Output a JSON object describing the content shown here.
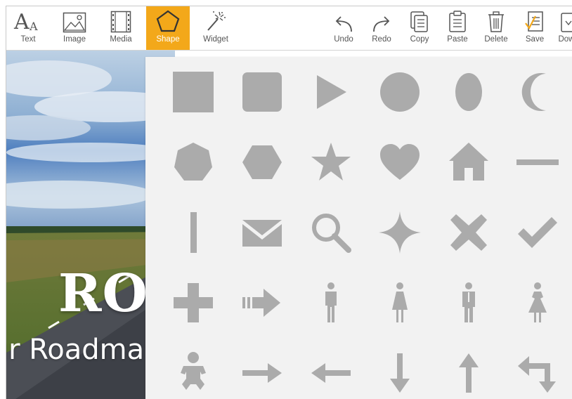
{
  "toolbar": {
    "left_tools": [
      {
        "name": "text",
        "label": "Text",
        "icon": "text-icon"
      },
      {
        "name": "image",
        "label": "Image",
        "icon": "image-icon"
      },
      {
        "name": "media",
        "label": "Media",
        "icon": "film-icon"
      },
      {
        "name": "shape",
        "label": "Shape",
        "icon": "pentagon-icon",
        "active": true
      },
      {
        "name": "widget",
        "label": "Widget",
        "icon": "magic-wand-icon"
      }
    ],
    "right_tools": [
      {
        "name": "undo",
        "label": "Undo",
        "icon": "undo-icon"
      },
      {
        "name": "redo",
        "label": "Redo",
        "icon": "redo-icon"
      },
      {
        "name": "copy",
        "label": "Copy",
        "icon": "copy-icon"
      },
      {
        "name": "paste",
        "label": "Paste",
        "icon": "paste-icon"
      },
      {
        "name": "delete",
        "label": "Delete",
        "icon": "trash-icon"
      },
      {
        "name": "save",
        "label": "Save",
        "icon": "save-document-icon"
      },
      {
        "name": "download",
        "label": "Dow",
        "icon": "download-icon"
      }
    ],
    "active_color": "#f3a81a"
  },
  "canvas": {
    "title": "ROA",
    "subtitle": "ır Roadma"
  },
  "shapes": {
    "fill_color": "#ababab",
    "items": [
      "square",
      "rounded-square",
      "triangle-right",
      "circle",
      "ellipse",
      "crescent",
      "heptagon",
      "hexagon",
      "star",
      "heart",
      "house",
      "horizontal-line",
      "vertical-line",
      "envelope",
      "magnifier",
      "four-point-star",
      "x-cross",
      "checkmark",
      "plus",
      "right-arrow-dashed",
      "man",
      "woman",
      "man-suit",
      "woman-dress",
      "baby",
      "right-arrow",
      "left-arrow",
      "down-arrow",
      "up-arrow",
      "turn-arrow"
    ]
  }
}
